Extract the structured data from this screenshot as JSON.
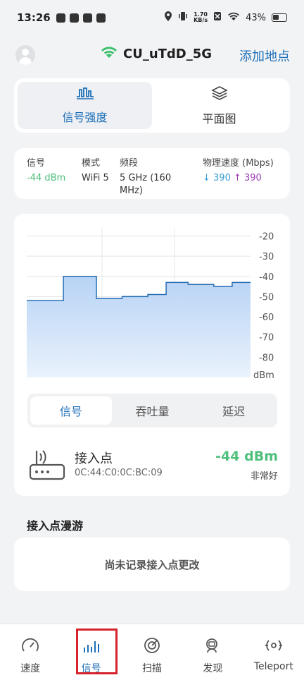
{
  "status_bar": {
    "time": "13:26",
    "net_speed_top": "1.70",
    "net_speed_unit": "KB/s",
    "battery": "43%"
  },
  "header": {
    "ssid": "CU_uTdD_5G",
    "add_point": "添加地点"
  },
  "view_tabs": [
    {
      "label": "信号强度",
      "icon": "signal-wave-icon",
      "active": true
    },
    {
      "label": "平面图",
      "icon": "layers-icon",
      "active": false
    }
  ],
  "info": {
    "signal_label": "信号",
    "signal_value": "-44 dBm",
    "mode_label": "模式",
    "mode_value": "WiFi 5",
    "band_label": "频段",
    "band_value_line1": "5 GHz (160",
    "band_value_line2": "MHz)",
    "phy_label": "物理速度 (Mbps)",
    "phy_down": "↓ 390",
    "phy_up": "↑ 390",
    "down_color": "#3aa0d8",
    "up_color": "#9b3fb3"
  },
  "chart_data": {
    "type": "area",
    "ylabel": "dBm",
    "y_ticks": [
      -20,
      -30,
      -40,
      -50,
      -60,
      -70,
      -80
    ],
    "ylim": [
      -90,
      -16
    ],
    "x": [
      0,
      1,
      2,
      3,
      4,
      5,
      6,
      7,
      8,
      9,
      10,
      11,
      12
    ],
    "values": [
      -52,
      -52,
      -40,
      -40,
      -51,
      -50,
      -50,
      -48,
      -43,
      -43,
      -44,
      -44,
      -45,
      -45,
      -43
    ],
    "step_series": [
      [
        0,
        -52
      ],
      [
        1,
        -52
      ],
      [
        1,
        -40
      ],
      [
        1.9,
        -40
      ],
      [
        1.9,
        -51
      ],
      [
        2.6,
        -51
      ],
      [
        2.6,
        -50
      ],
      [
        3.3,
        -50
      ],
      [
        3.3,
        -49
      ],
      [
        3.8,
        -49
      ],
      [
        3.8,
        -43
      ],
      [
        4.4,
        -43
      ],
      [
        4.4,
        -44
      ],
      [
        5.1,
        -44
      ],
      [
        5.1,
        -45
      ],
      [
        5.6,
        -45
      ],
      [
        5.6,
        -43
      ],
      [
        6.1,
        -43
      ]
    ],
    "xlim": [
      0,
      6.1
    ],
    "fill_color": "#b7d3f5",
    "line_color": "#2a6fb4",
    "grid": true
  },
  "metric_tabs": [
    {
      "label": "信号",
      "active": true
    },
    {
      "label": "吞吐量",
      "active": false
    },
    {
      "label": "延迟",
      "active": false
    }
  ],
  "access_point": {
    "title": "接入点",
    "mac": "0C:44:C0:0C:BC:09",
    "dbm": "-44 dBm",
    "quality": "非常好"
  },
  "roaming": {
    "title": "接入点漫游",
    "empty_text": "尚未记录接入点更改"
  },
  "bottom_nav": [
    {
      "label": "速度",
      "icon": "speedometer-icon",
      "active": false
    },
    {
      "label": "信号",
      "icon": "signal-bars-icon",
      "active": true
    },
    {
      "label": "扫描",
      "icon": "radar-icon",
      "active": false
    },
    {
      "label": "发现",
      "icon": "discover-icon",
      "active": false
    },
    {
      "label": "Teleport",
      "icon": "teleport-icon",
      "active": false
    }
  ]
}
